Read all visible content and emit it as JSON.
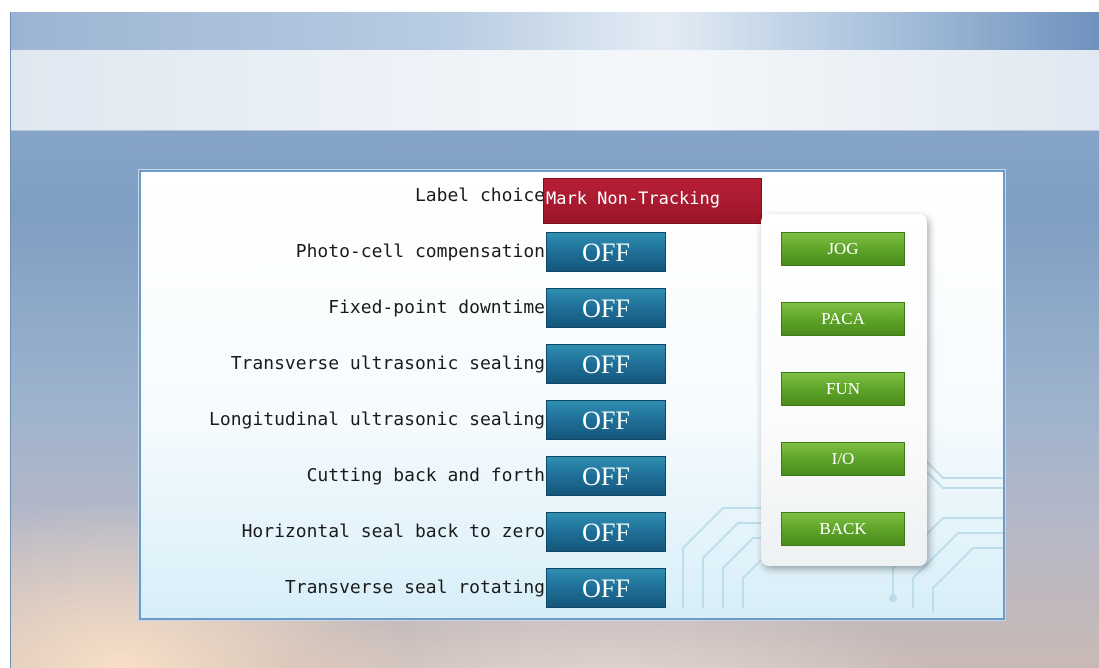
{
  "label_choice": {
    "label": "Label choice",
    "value": "Mark Non-Tracking"
  },
  "settings": [
    {
      "label": "Photo-cell compensation",
      "state": "OFF"
    },
    {
      "label": "Fixed-point downtime",
      "state": "OFF"
    },
    {
      "label": "Transverse ultrasonic sealing",
      "state": "OFF"
    },
    {
      "label": "Longitudinal ultrasonic sealing",
      "state": "OFF"
    },
    {
      "label": "Cutting back and forth",
      "state": "OFF"
    },
    {
      "label": "Horizontal seal back to zero",
      "state": "OFF"
    },
    {
      "label": "Transverse seal rotating",
      "state": "OFF"
    }
  ],
  "nav": {
    "jog": "JOG",
    "paca": "PACA",
    "fun": "FUN",
    "io": "I/O",
    "back": "BACK"
  },
  "colors": {
    "toggle_blue": "#1f6f98",
    "label_choice_red": "#a8192f",
    "nav_green": "#5ea529"
  }
}
